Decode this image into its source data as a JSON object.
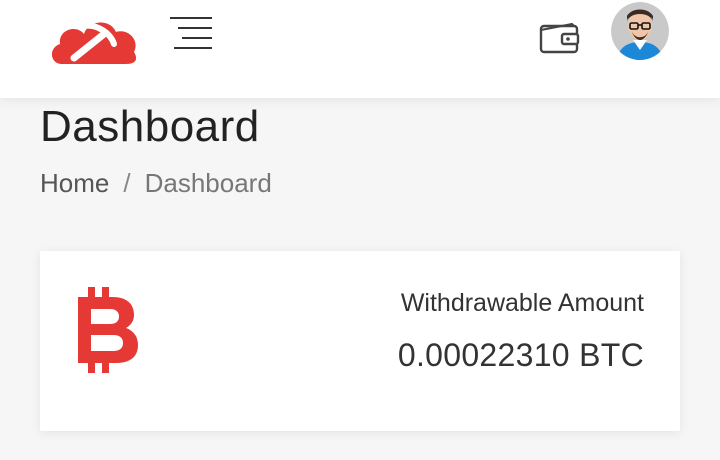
{
  "header": {
    "logo_icon": "cloud-pickaxe-logo",
    "menu_icon": "hamburger-menu-icon",
    "wallet_icon": "wallet-icon",
    "avatar_icon": "user-avatar",
    "brand_color": "#e53935"
  },
  "page": {
    "title": "Dashboard",
    "breadcrumb": {
      "home": "Home",
      "separator": "/",
      "current": "Dashboard"
    }
  },
  "card": {
    "icon": "bitcoin-icon",
    "label": "Withdrawable Amount",
    "value": "0.00022310 BTC",
    "accent": "#e53935"
  }
}
